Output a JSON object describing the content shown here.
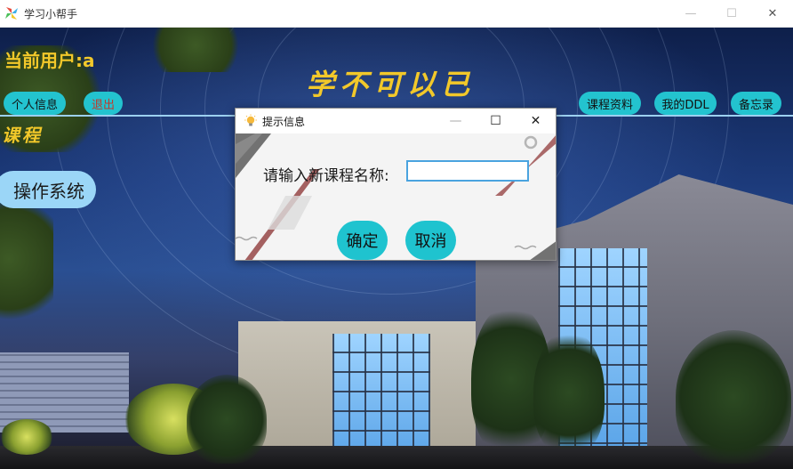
{
  "window": {
    "title": "学习小帮手",
    "minimize_glyph": "—",
    "maximize_glyph": "☐",
    "close_glyph": "✕"
  },
  "header": {
    "current_user": "当前用户:a",
    "slogan": "学不可以已"
  },
  "nav": {
    "profile": "个人信息",
    "logout": "退出",
    "course_materials": "课程资料",
    "my_ddl": "我的DDL",
    "memo": "备忘录"
  },
  "sidebar": {
    "heading": "课程",
    "courses": [
      "操作系统"
    ]
  },
  "dialog": {
    "title": "提示信息",
    "minimize_glyph": "—",
    "maximize_glyph": "☐",
    "close_glyph": "✕",
    "prompt_label": "请输入新课程名称:",
    "input_value": "",
    "confirm_label": "确定",
    "cancel_label": "取消"
  },
  "colors": {
    "accent_pill": "#23c3cf",
    "title_yellow": "#f2c82a",
    "course_pill": "#9bd6f7",
    "logout_text": "#c0392b"
  },
  "icons": {
    "app": "colorful-pinwheel-icon",
    "dialog": "lightbulb-icon"
  }
}
